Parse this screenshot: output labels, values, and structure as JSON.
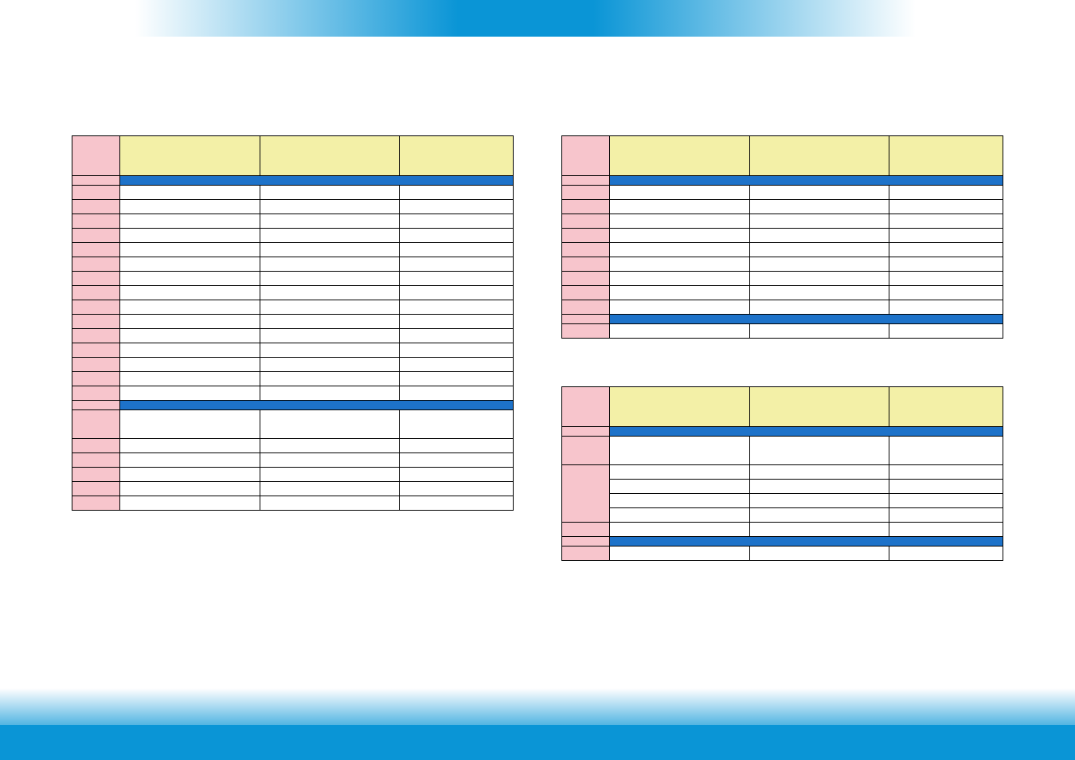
{
  "table1": {
    "headers": [
      "",
      "",
      "",
      ""
    ],
    "section1_label": "",
    "section2_label": "",
    "rows_s1": [
      "",
      "",
      "",
      "",
      "",
      "",
      "",
      "",
      "",
      "",
      "",
      "",
      "",
      "",
      ""
    ],
    "tall_row": "",
    "rows_s2": [
      "",
      "",
      "",
      "",
      ""
    ]
  },
  "table2": {
    "headers": [
      "",
      "",
      "",
      ""
    ],
    "section_label": "",
    "rows": [
      "",
      "",
      "",
      "",
      "",
      "",
      "",
      "",
      ""
    ],
    "blue_row": "",
    "last_row": ""
  },
  "table3": {
    "headers": [
      "",
      "",
      "",
      ""
    ],
    "section_label": "",
    "tall_row1": "",
    "tall_row2": "",
    "rows": [
      "",
      "",
      "",
      "",
      ""
    ],
    "blue_row": "",
    "last_row": ""
  }
}
